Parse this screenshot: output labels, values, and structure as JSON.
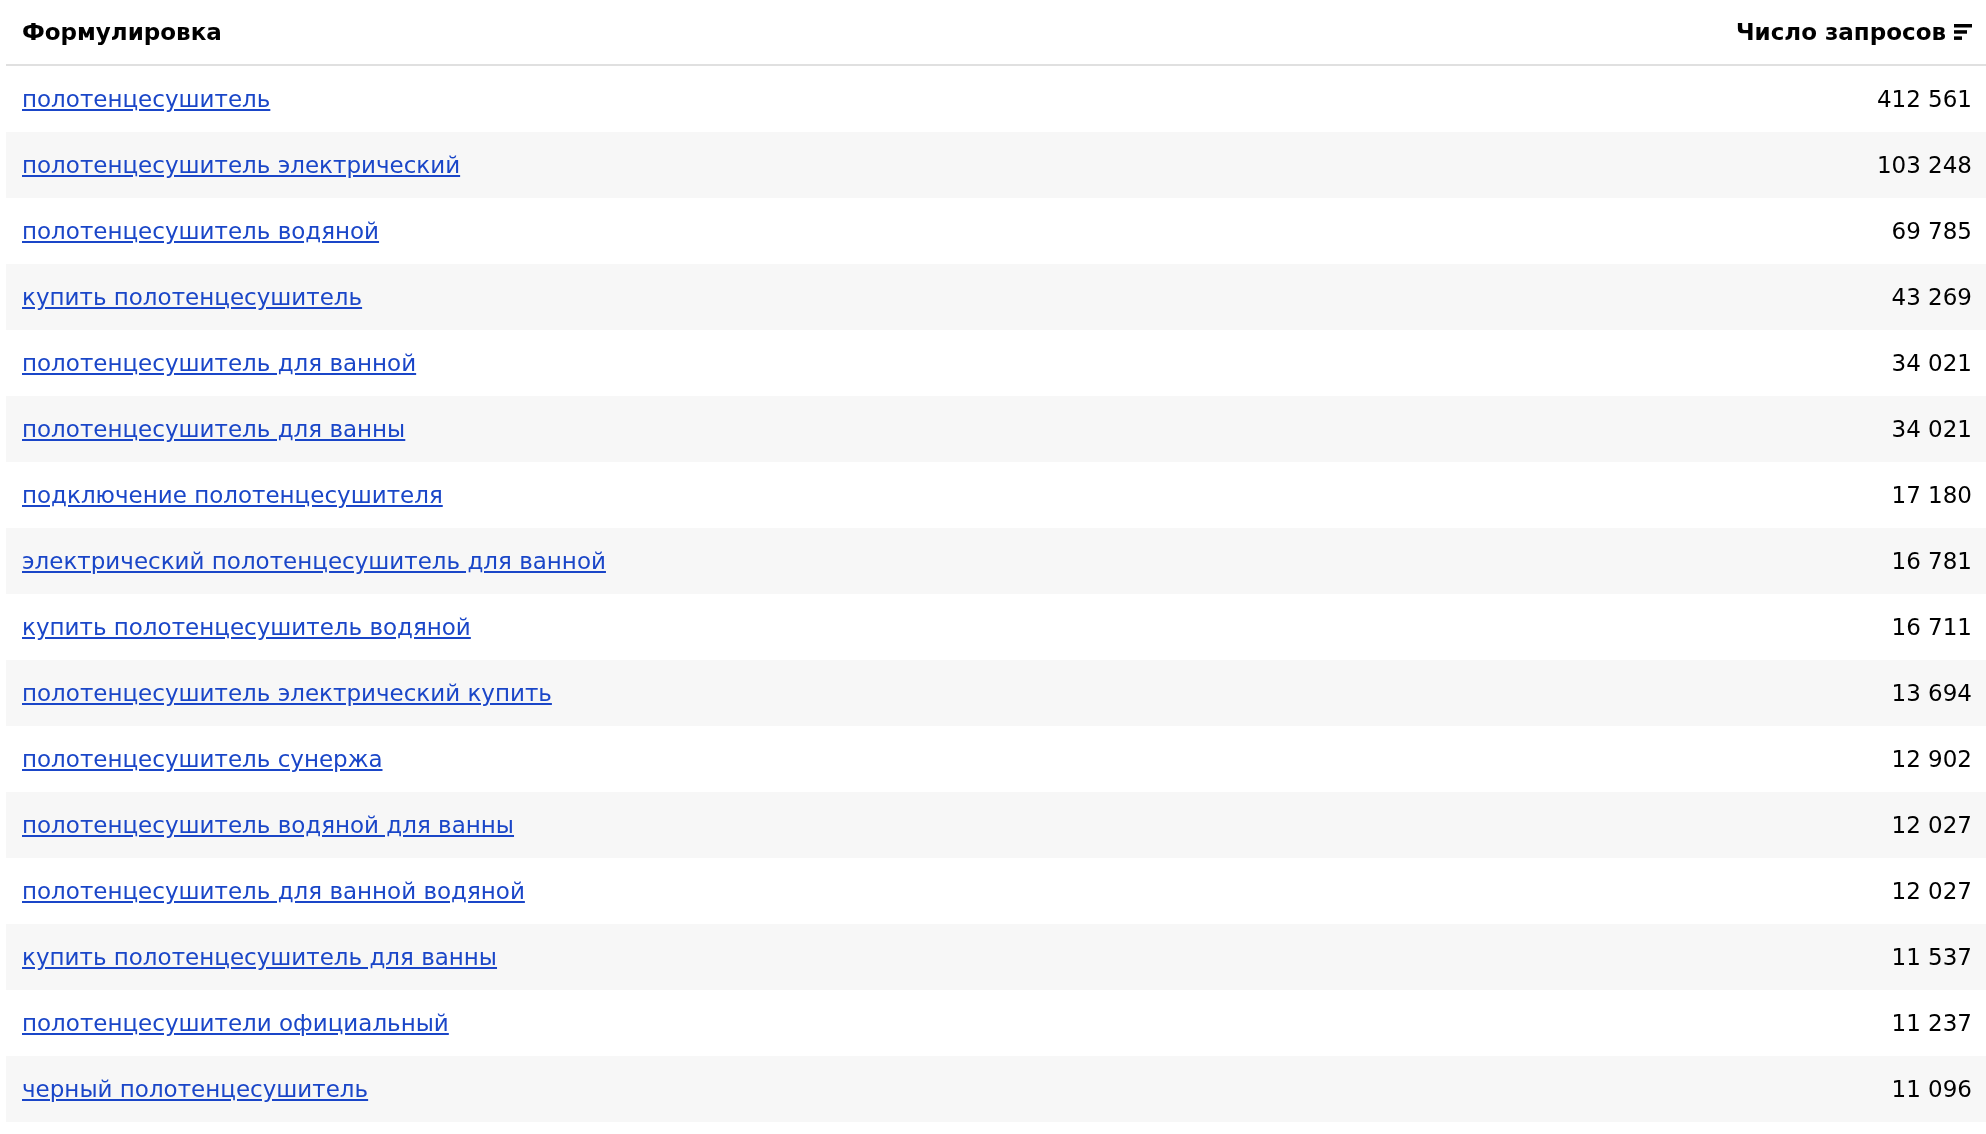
{
  "table": {
    "columns": [
      {
        "label": "Формулировка"
      },
      {
        "label": "Число запросов",
        "sorted": true
      }
    ],
    "rows": [
      {
        "phrase": "полотенцесушитель",
        "count": "412 561"
      },
      {
        "phrase": "полотенцесушитель электрический",
        "count": "103 248"
      },
      {
        "phrase": "полотенцесушитель водяной",
        "count": "69 785"
      },
      {
        "phrase": "купить полотенцесушитель",
        "count": "43 269"
      },
      {
        "phrase": "полотенцесушитель для ванной",
        "count": "34 021"
      },
      {
        "phrase": "полотенцесушитель для ванны",
        "count": "34 021"
      },
      {
        "phrase": "подключение полотенцесушителя",
        "count": "17 180"
      },
      {
        "phrase": "электрический полотенцесушитель для ванной",
        "count": "16 781"
      },
      {
        "phrase": "купить полотенцесушитель водяной",
        "count": "16 711"
      },
      {
        "phrase": "полотенцесушитель электрический купить",
        "count": "13 694"
      },
      {
        "phrase": "полотенцесушитель сунержа",
        "count": "12 902"
      },
      {
        "phrase": "полотенцесушитель водяной для ванны",
        "count": "12 027"
      },
      {
        "phrase": "полотенцесушитель для ванной водяной",
        "count": "12 027"
      },
      {
        "phrase": "купить полотенцесушитель для ванны",
        "count": "11 537"
      },
      {
        "phrase": "полотенцесушители официальный",
        "count": "11 237"
      },
      {
        "phrase": "черный полотенцесушитель",
        "count": "11 096"
      }
    ]
  }
}
